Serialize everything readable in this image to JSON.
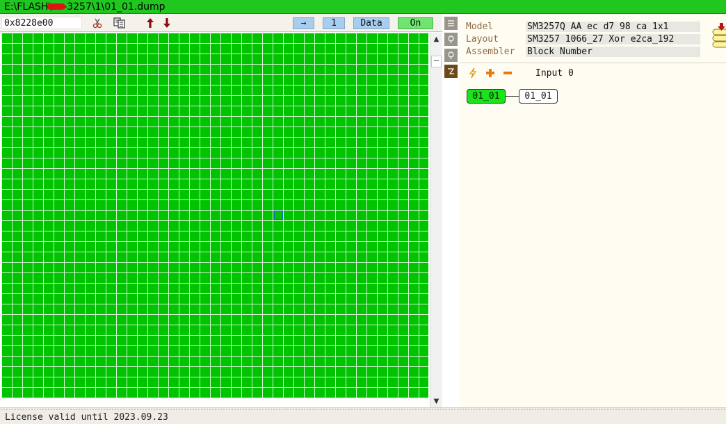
{
  "window": {
    "title_prefix": "E:\\FLASH\\",
    "title_suffix": "-3257\\1\\01_01.dump"
  },
  "toolbar": {
    "address_value": "0x8228e00",
    "icons": [
      "scissors-icon",
      "copy-icon",
      "arrow-up-icon",
      "arrow-down-icon"
    ],
    "direction_button": "→",
    "step_button": "1",
    "data_button": "Data",
    "on_button": "On"
  },
  "grid": {
    "cell_color": "#00c400",
    "line_color": "#d6f3d6",
    "cursor_color": "#1d5ad8"
  },
  "scrollbar": {
    "up_arrow": "▲",
    "down_arrow": "▼",
    "minus": "–"
  },
  "info": {
    "model_label": "Model",
    "model_value": "SM3257Q AA  ec d7 98 ca  1x1",
    "layout_label": "Layout",
    "layout_value": "SM3257 1066_27 Xor e2ca_192",
    "assembler_label": "Assembler",
    "assembler_value": "Block Number"
  },
  "assembler_tools": {
    "icons": [
      "lightning-icon",
      "plus-icon",
      "minus-icon"
    ],
    "input_label": "Input 0"
  },
  "nodes": {
    "source": "01_01",
    "target": "01_01"
  },
  "status": {
    "license": "License valid until 2023.09.23"
  },
  "colors": {
    "title_bar": "#1fc71f",
    "accent_green": "#6fe46f",
    "button_blue": "#a7cdef",
    "label_brown": "#8b6b43",
    "panel_bg": "#fffcf2"
  }
}
